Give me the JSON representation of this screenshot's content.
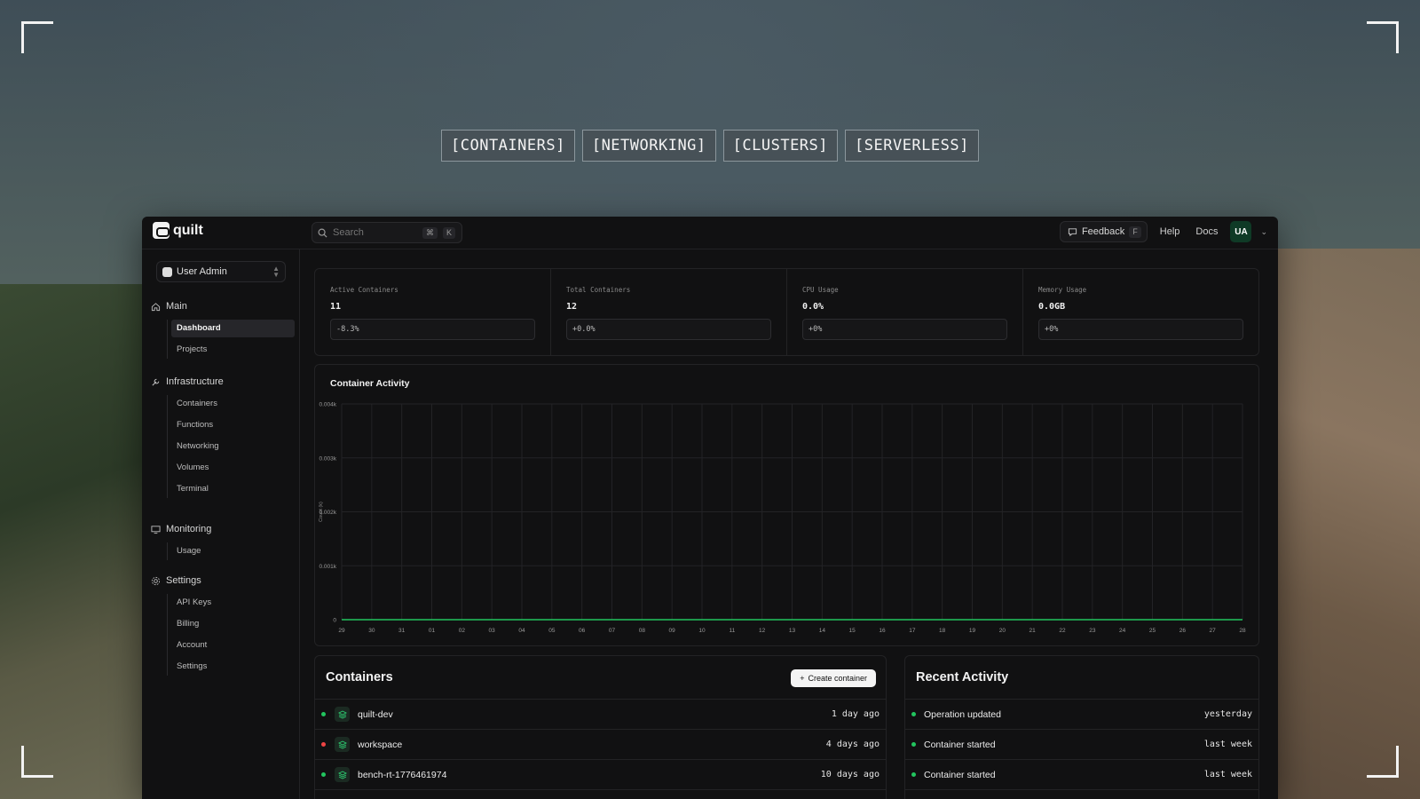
{
  "hero_tabs": [
    "[CONTAINERS]",
    "[NETWORKING]",
    "[CLUSTERS]",
    "[SERVERLESS]"
  ],
  "app": {
    "logo_text": "quilt",
    "search": {
      "placeholder": "Search",
      "kbd_mod": "⌘",
      "kbd_key": "K"
    },
    "topbar": {
      "feedback_label": "Feedback",
      "feedback_key": "F",
      "help_label": "Help",
      "docs_label": "Docs",
      "avatar_initials": "UA"
    },
    "org_switcher": "User Admin"
  },
  "sidebar": {
    "main": {
      "title": "Main",
      "items": [
        "Dashboard",
        "Projects"
      ],
      "active": "Dashboard"
    },
    "infrastructure": {
      "title": "Infrastructure",
      "items": [
        "Containers",
        "Functions",
        "Networking",
        "Volumes",
        "Terminal"
      ]
    },
    "monitoring": {
      "title": "Monitoring",
      "items": [
        "Usage"
      ]
    },
    "settings": {
      "title": "Settings",
      "items": [
        "API Keys",
        "Billing",
        "Account",
        "Settings"
      ]
    }
  },
  "stats": [
    {
      "label": "Active Containers",
      "value": "11",
      "delta": "-8.3%"
    },
    {
      "label": "Total Containers",
      "value": "12",
      "delta": "+0.0%"
    },
    {
      "label": "CPU Usage",
      "value": "0.0%",
      "delta": "+0%"
    },
    {
      "label": "Memory Usage",
      "value": "0.0GB",
      "delta": "+0%"
    }
  ],
  "chart_data": {
    "type": "line",
    "title": "Container Activity",
    "ylabel": "Count (k)",
    "ytick_labels": [
      "0",
      "0.001k",
      "0.002k",
      "0.003k",
      "0.004k"
    ],
    "ylim": [
      0,
      4
    ],
    "x": [
      "29",
      "30",
      "31",
      "01",
      "02",
      "03",
      "04",
      "05",
      "06",
      "07",
      "08",
      "09",
      "10",
      "11",
      "12",
      "13",
      "14",
      "15",
      "16",
      "17",
      "18",
      "19",
      "20",
      "21",
      "22",
      "23",
      "24",
      "25",
      "26",
      "27",
      "28"
    ],
    "series": [
      {
        "values": [
          0,
          0,
          0,
          0,
          0,
          0,
          0,
          0,
          0,
          0,
          0,
          0,
          0,
          0,
          0,
          0,
          0,
          0,
          0,
          0,
          0,
          0,
          0,
          0,
          0,
          0,
          0,
          0,
          0,
          0,
          0
        ],
        "color": "#22c55e"
      }
    ],
    "grid": true
  },
  "containers": {
    "title": "Containers",
    "create_label": "Create container",
    "rows": [
      {
        "name": "quilt-dev",
        "time": "1 day ago",
        "status_color": "#22c55e"
      },
      {
        "name": "workspace",
        "time": "4 days ago",
        "status_color": "#ef4444"
      },
      {
        "name": "bench-rt-1776461974",
        "time": "10 days ago",
        "status_color": "#22c55e"
      }
    ]
  },
  "recent_activity": {
    "title": "Recent Activity",
    "rows": [
      {
        "text": "Operation updated",
        "time": "yesterday"
      },
      {
        "text": "Container started",
        "time": "last week"
      },
      {
        "text": "Container started",
        "time": "last week"
      }
    ]
  }
}
